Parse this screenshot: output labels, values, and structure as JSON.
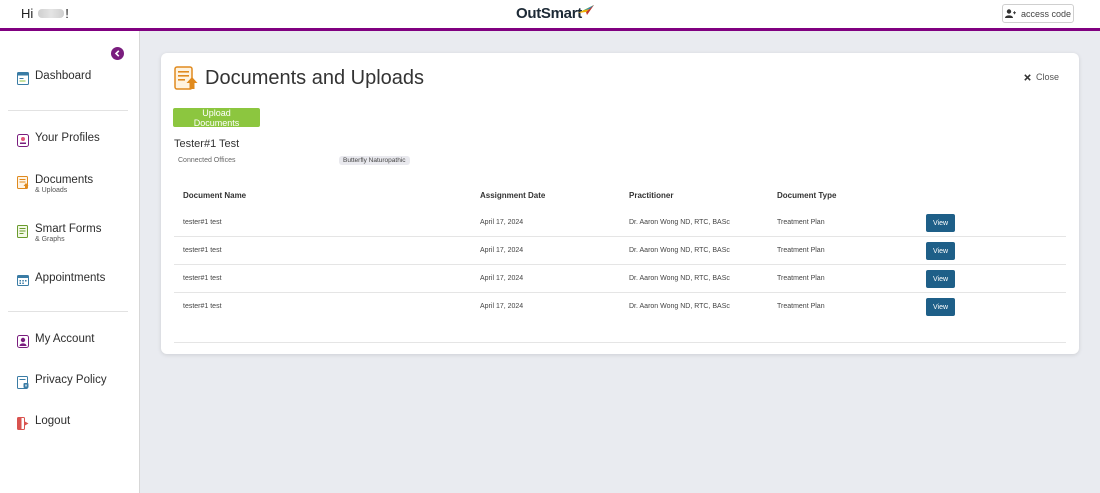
{
  "header": {
    "greeting_prefix": "Hi",
    "greeting_suffix": "!",
    "logo_text": "OutSmart",
    "access_code_label": "access code"
  },
  "sidebar": {
    "items": [
      {
        "label": "Dashboard",
        "sub": "",
        "icon": "dashboard-icon"
      },
      {
        "label": "Your Profiles",
        "sub": "",
        "icon": "profile-icon"
      },
      {
        "label": "Documents",
        "sub": "& Uploads",
        "icon": "documents-icon"
      },
      {
        "label": "Smart Forms",
        "sub": "& Graphs",
        "icon": "forms-icon"
      },
      {
        "label": "Appointments",
        "sub": "",
        "icon": "calendar-icon"
      },
      {
        "label": "My Account",
        "sub": "",
        "icon": "account-icon"
      },
      {
        "label": "Privacy Policy",
        "sub": "",
        "icon": "privacy-icon"
      },
      {
        "label": "Logout",
        "sub": "",
        "icon": "logout-icon"
      }
    ]
  },
  "main": {
    "title": "Documents and Uploads",
    "close_label": "Close",
    "upload_label": "Upload Documents",
    "profile_name": "Tester#1 Test",
    "connected_offices_label": "Connected Offices",
    "office_badge": "Butterfly Naturopathic",
    "table": {
      "headers": [
        "Document Name",
        "Assignment Date",
        "Practitioner",
        "Document Type"
      ],
      "rows": [
        {
          "name": "tester#1 test",
          "date": "April 17, 2024",
          "practitioner": "Dr. Aaron Wong ND, RTC, BASc",
          "type": "Treatment Plan",
          "action": "View"
        },
        {
          "name": "tester#1 test",
          "date": "April 17, 2024",
          "practitioner": "Dr. Aaron Wong ND, RTC, BASc",
          "type": "Treatment Plan",
          "action": "View"
        },
        {
          "name": "tester#1 test",
          "date": "April 17, 2024",
          "practitioner": "Dr. Aaron Wong ND, RTC, BASc",
          "type": "Treatment Plan",
          "action": "View"
        },
        {
          "name": "tester#1 test",
          "date": "April 17, 2024",
          "practitioner": "Dr. Aaron Wong ND, RTC, BASc",
          "type": "Treatment Plan",
          "action": "View"
        }
      ]
    }
  },
  "colors": {
    "brand_purple": "#800080",
    "upload_green": "#8cc63f",
    "view_blue": "#1e5f88",
    "page_bg": "#e9ebf0"
  }
}
